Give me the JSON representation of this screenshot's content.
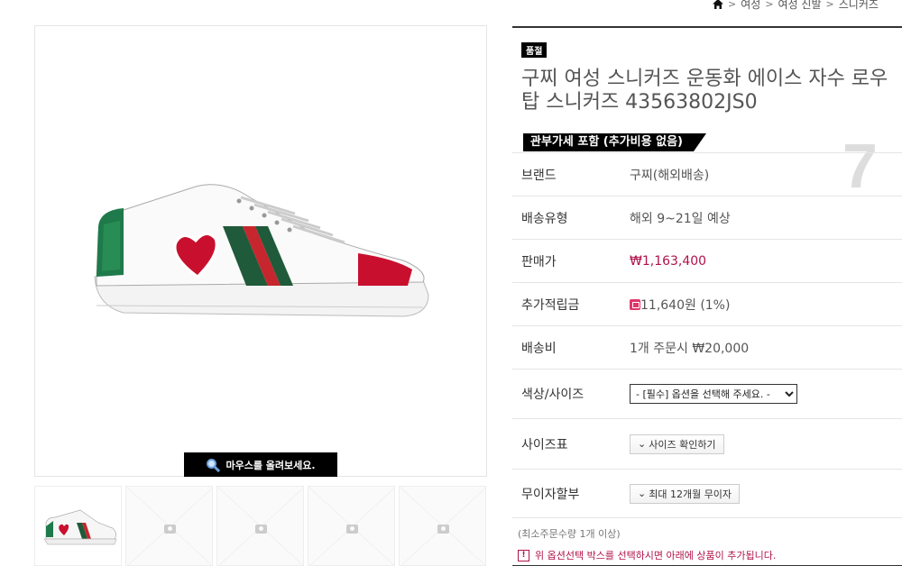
{
  "breadcrumb": {
    "items": [
      "여성",
      "여성 신발",
      "스니커즈"
    ]
  },
  "gallery": {
    "zoom_hint": "마우스를 올려보세요.",
    "thumbnails": [
      "shoe",
      "placeholder",
      "placeholder",
      "placeholder",
      "placeholder"
    ]
  },
  "product": {
    "soldout_badge": "품절",
    "title": "구찌 여성 스니커즈 운동화 에이스 자수 로우탑 스니커즈 43563802JS0",
    "tax_banner": "관부가세 포함 (추가비용 없음)",
    "big_number": "7"
  },
  "details": {
    "brand": {
      "label": "브랜드",
      "value": "구찌(해외배송)"
    },
    "shipping_type": {
      "label": "배송유형",
      "value": "해외 9~21일 예상"
    },
    "price": {
      "label": "판매가",
      "value": "₩1,163,400"
    },
    "points": {
      "label": "추가적립금",
      "value": "11,640원 (1%)"
    },
    "shipping_fee": {
      "label": "배송비",
      "value": "1개 주문시 ₩20,000"
    },
    "option": {
      "label": "색상/사이즈",
      "selected": "- [필수] 옵션을 선택해 주세요. -"
    },
    "size_chart": {
      "label": "사이즈표",
      "button": "사이즈 확인하기"
    },
    "installment": {
      "label": "무이자할부",
      "button": "최대 12개월 무이자"
    }
  },
  "min_qty": "(최소주문수량 1개 이상)",
  "notice": "위 옵션선택 박스를 선택하시면 아래에 상품이 추가됩니다.",
  "colors": {
    "price": "#b0124a",
    "accent": "#000000"
  }
}
